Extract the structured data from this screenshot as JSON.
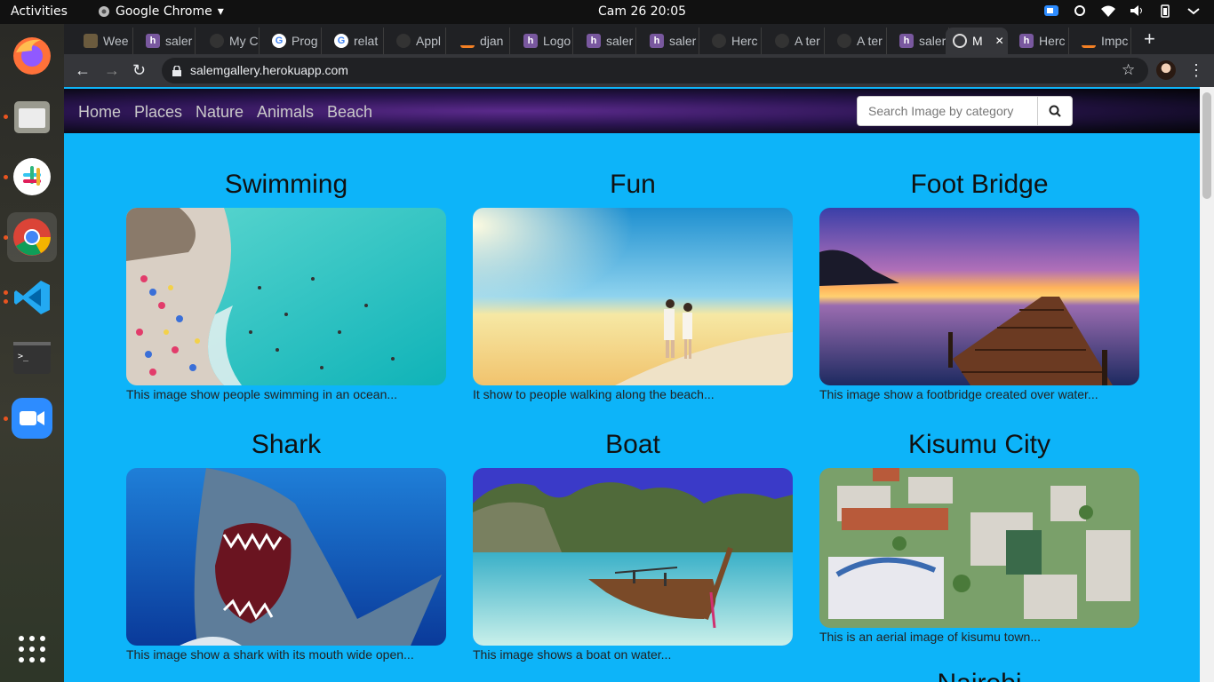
{
  "system": {
    "activities": "Activities",
    "app_name": "Google Chrome",
    "clock": "Cam 26  20:05"
  },
  "browser": {
    "tabs": [
      {
        "label": "Wee",
        "icon": "plant-icon",
        "color": "#6b5b3e"
      },
      {
        "label": "saler",
        "icon": "heroku-icon",
        "color": "#79589f"
      },
      {
        "label": "My C",
        "icon": "github-icon",
        "color": "#333"
      },
      {
        "label": "Prog",
        "icon": "google-icon",
        "color": "#fff"
      },
      {
        "label": "relat",
        "icon": "google-icon",
        "color": "#fff"
      },
      {
        "label": "Appl",
        "icon": "github-icon",
        "color": "#333"
      },
      {
        "label": "djan",
        "icon": "stackoverflow-icon",
        "color": "#f48024"
      },
      {
        "label": "Logo",
        "icon": "heroku-icon",
        "color": "#79589f"
      },
      {
        "label": "saler",
        "icon": "heroku-icon",
        "color": "#79589f"
      },
      {
        "label": "saler",
        "icon": "heroku-icon",
        "color": "#79589f"
      },
      {
        "label": "Herc",
        "icon": "github-icon",
        "color": "#333"
      },
      {
        "label": "A ter",
        "icon": "github-icon",
        "color": "#333"
      },
      {
        "label": "A ter",
        "icon": "github-icon",
        "color": "#333"
      },
      {
        "label": "saler",
        "icon": "heroku-icon",
        "color": "#79589f"
      },
      {
        "label": "M",
        "icon": "globe-icon",
        "color": "#fff",
        "active": true
      },
      {
        "label": "Herc",
        "icon": "heroku-icon",
        "color": "#79589f"
      },
      {
        "label": "Impc",
        "icon": "stackoverflow-icon",
        "color": "#f48024"
      }
    ],
    "url": "salemgallery.herokuapp.com"
  },
  "site": {
    "nav": [
      "Home",
      "Places",
      "Nature",
      "Animals",
      "Beach"
    ],
    "search_placeholder": "Search Image by category",
    "cards": [
      {
        "title": "Swimming",
        "caption": "This image show people swimming in an ocean..."
      },
      {
        "title": "Fun",
        "caption": "It show to people walking along the beach..."
      },
      {
        "title": "Foot Bridge",
        "caption": "This image show a footbridge created over water..."
      },
      {
        "title": "Shark",
        "caption": "This image show a shark with its mouth wide open..."
      },
      {
        "title": "Boat",
        "caption": "This image shows a boat on water..."
      },
      {
        "title": "Kisumu City",
        "caption": "This is an aerial image of kisumu town..."
      }
    ],
    "next_title": "Nairobi"
  },
  "colors": {
    "page_bg": "#0db4f9",
    "navbar": "#2a1450"
  }
}
